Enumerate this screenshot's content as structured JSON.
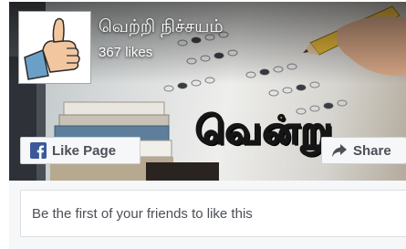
{
  "page": {
    "name": "வெற்றி நிச்சயம்",
    "likes": "367 likes",
    "banner_text": "வென்று"
  },
  "buttons": {
    "like_label": "Like Page",
    "share_label": "Share"
  },
  "friends": {
    "text": "Be the first of your friends to like this"
  },
  "icons": {
    "like": "facebook-f-icon",
    "share": "share-arrow-icon",
    "profile": "thumbs-up-cartoon"
  },
  "colors": {
    "facebook_blue": "#3b5998",
    "banner_yellow": "#f4d600",
    "button_text": "#4b4f56"
  }
}
